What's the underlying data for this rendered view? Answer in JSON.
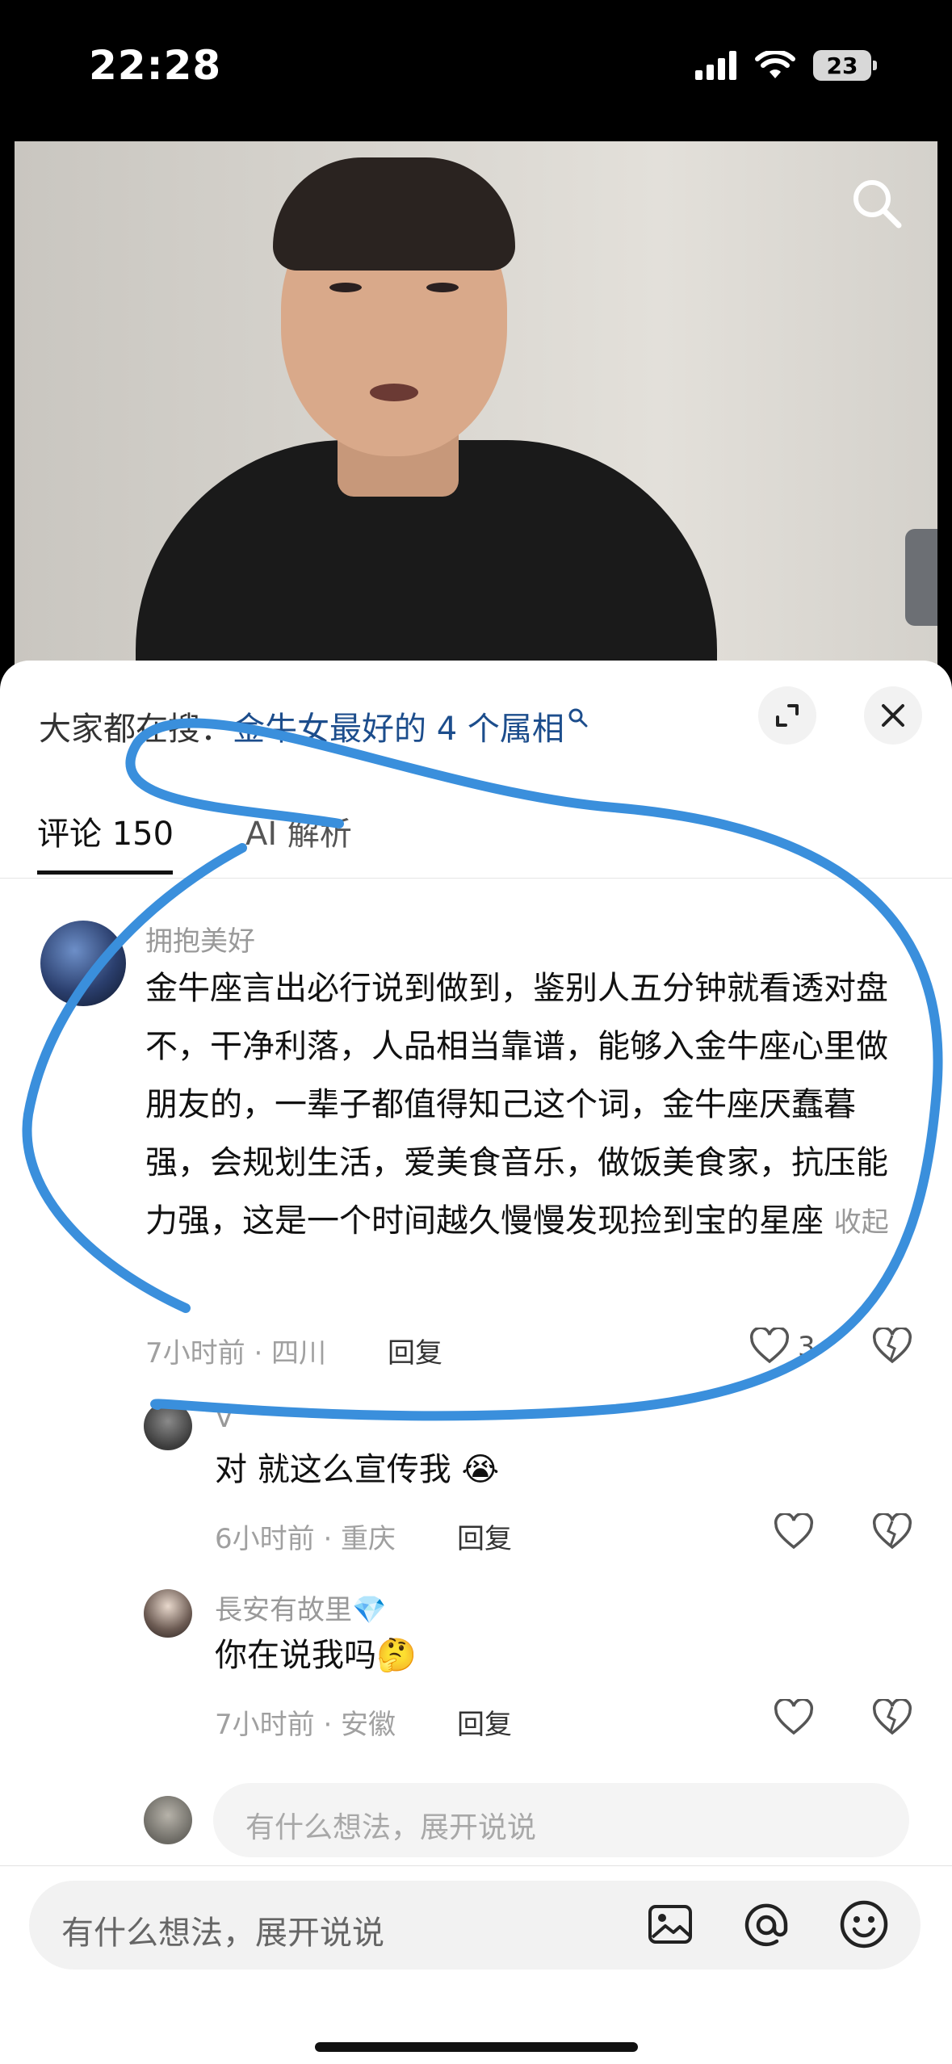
{
  "status": {
    "time": "22:28",
    "battery": "23"
  },
  "sheet": {
    "search_prefix": "大家都在搜：",
    "search_link": "金牛女最好的 4 个属相"
  },
  "tabs": [
    {
      "label": "评论 150"
    },
    {
      "label": "AI 解析"
    }
  ],
  "comments": [
    {
      "name": "拥抱美好",
      "text": "金牛座言出必行说到做到，鉴别人五分钟就看透对盘不，干净利落，人品相当靠谱，能够入金牛座心里做朋友的，一辈子都值得知己这个词，金牛座厌蠢暮强，会规划生活，爱美食音乐，做饭美食家，抗压能力强，这是一个时间越久慢慢发现捡到宝的星座",
      "collapse": "收起",
      "meta": "7小时前 · 四川",
      "reply": "回复",
      "likes": "3"
    }
  ],
  "replies": [
    {
      "name": "V",
      "text": "对 就这么宣传我",
      "emoji": "😭",
      "meta": "6小时前 · 重庆",
      "reply": "回复"
    },
    {
      "name": "長安有故里",
      "badge": "💎",
      "text": "你在说我吗",
      "emoji": "🤔",
      "meta": "7小时前 · 安徽",
      "reply": "回复"
    }
  ],
  "reply_input": {
    "placeholder": "有什么想法，展开说说"
  },
  "bottom_input": {
    "placeholder": "有什么想法，展开说说"
  },
  "colors": {
    "annotation": "#3a8fdc",
    "link": "#1c4d8c"
  }
}
